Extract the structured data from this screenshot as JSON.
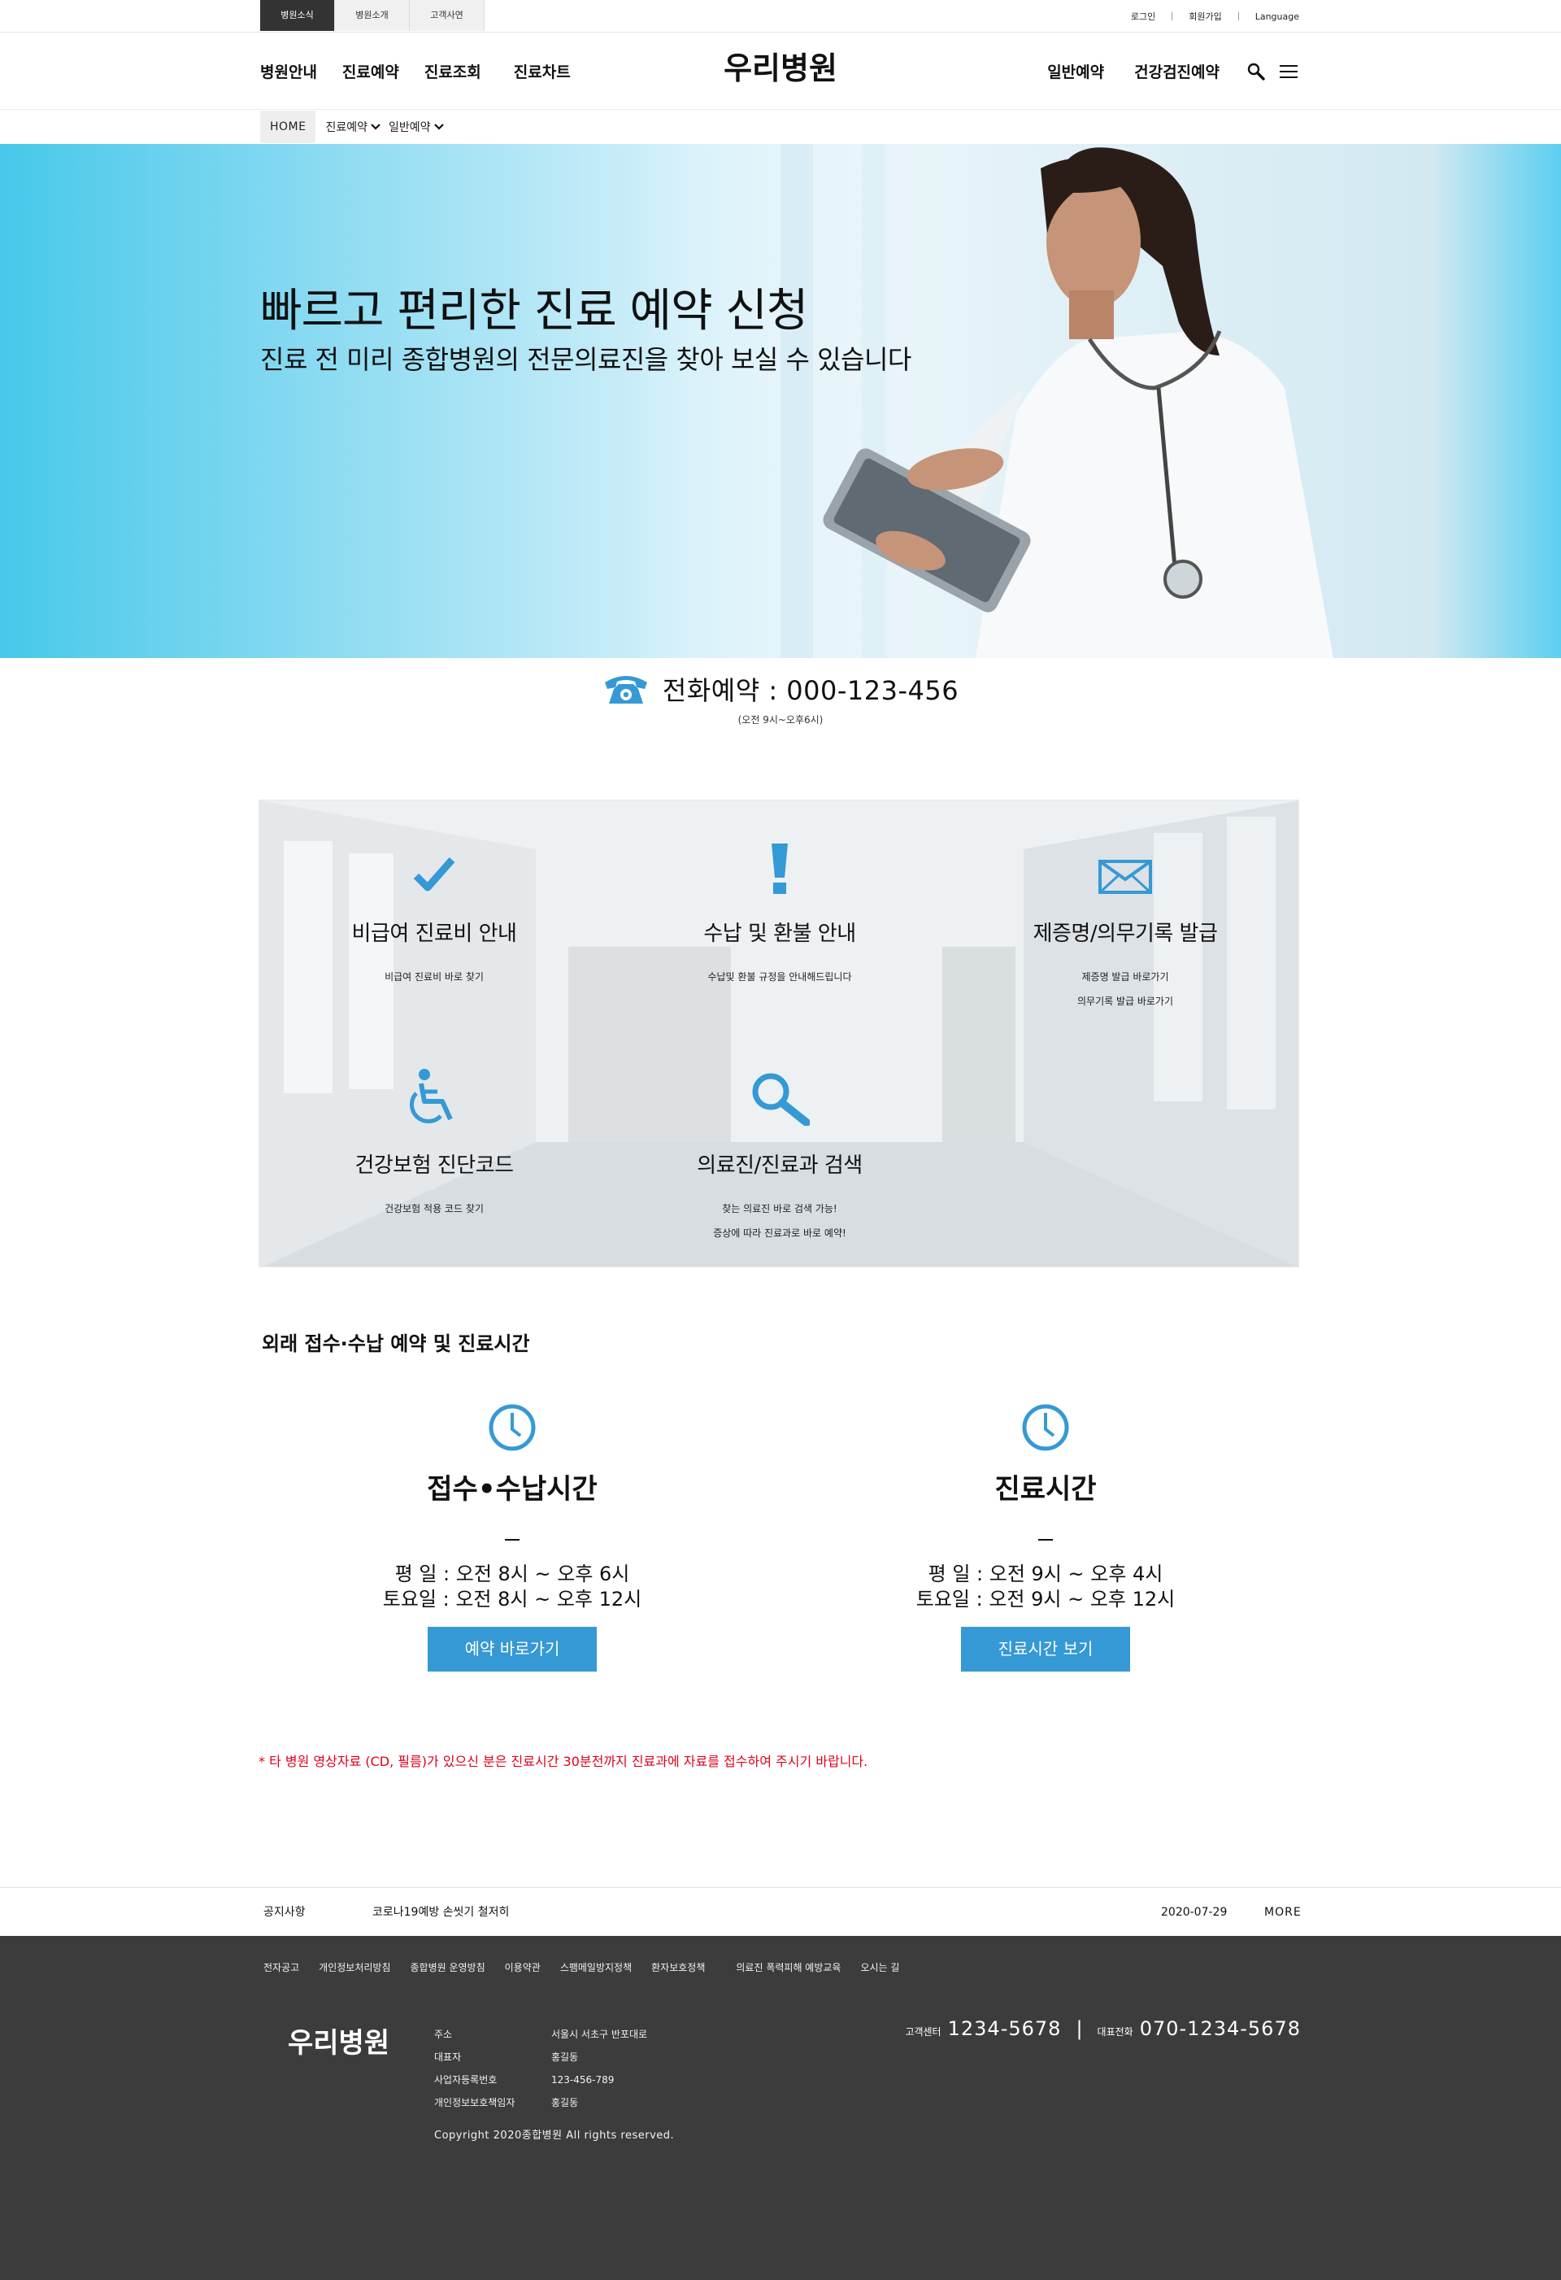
{
  "util_tabs": [
    "병원소식",
    "병원소개",
    "고객사연"
  ],
  "util_links": [
    "로그인",
    "회원가입",
    "Language"
  ],
  "header": {
    "nav_left": [
      "병원안내",
      "진료예약",
      "진료조회",
      "진료차트"
    ],
    "logo": "우리병원",
    "nav_right": [
      "일반예약",
      "건강검진예약"
    ]
  },
  "breadcrumb": {
    "home": "HOME",
    "items": [
      "진료예약",
      "일반예약"
    ]
  },
  "hero": {
    "title": "빠르고 편리한 진료 예약 신청",
    "subtitle": "진료 전 미리 종합병원의 전문의료진을 찾아 보실 수 있습니다"
  },
  "phone": {
    "label": "전화예약 : 000-123-456",
    "hours": "(오전 9시~오후6시)"
  },
  "services": [
    {
      "icon": "check-icon",
      "title": "비급여 진료비 안내",
      "lines": [
        "비급여 진료비 바로 찾기"
      ]
    },
    {
      "icon": "exclamation-icon",
      "title": "수납 및 환불 안내",
      "lines": [
        "수납및 환불 규정을 안내해드립니다"
      ]
    },
    {
      "icon": "envelope-icon",
      "title": "제증명/의무기록 발급",
      "lines": [
        "제증명 발급 바로가기",
        "의무기록 발급 바로가기"
      ]
    },
    {
      "icon": "wheelchair-icon",
      "title": "건강보험 진단코드",
      "lines": [
        "건강보험 적용 코드 찾기"
      ]
    },
    {
      "icon": "magnifier-icon",
      "title": "의료진/진료과 검색",
      "lines": [
        "찾는 의료진 바로 검색 가능!",
        "증상에 따라 진료과로 바로 예약!"
      ]
    }
  ],
  "hours": {
    "section_title": "외래 접수·수납 예약 및 진료시간",
    "columns": [
      {
        "title": "접수•수납시간",
        "rows": [
          "평 일 : 오전 8시 ~ 오후 6시",
          "토요일 : 오전 8시 ~ 오후 12시"
        ],
        "button": "예약 바로가기"
      },
      {
        "title": "진료시간",
        "rows": [
          "평 일 : 오전 9시 ~ 오후 4시",
          "토요일 : 오전 9시 ~ 오후 12시"
        ],
        "button": "진료시간 보기"
      }
    ]
  },
  "red_notice": "* 타 병원 영상자료 (CD, 필름)가 있으신 분은 진료시간 30분전까지 진료과에 자료를 접수하여 주시기 바랍니다.",
  "notice_bar": {
    "label": "공지사항",
    "text": "코로나19예방 손씻기 철저히",
    "date": "2020-07-29",
    "more": "MORE"
  },
  "footer": {
    "links": [
      "전자공고",
      "개인정보처리방침",
      "종합병원 운영방침",
      "이용약관",
      "스팸메일방지정책",
      "환자보호정책",
      "의료진 폭력피해 예방교육",
      "오시는 길"
    ],
    "logo": "우리병원",
    "info": [
      {
        "key": "주소",
        "value": "서울시 서초구 반포대로"
      },
      {
        "key": "대표자",
        "value": "홍길동"
      },
      {
        "key": "사업자등록번호",
        "value": "123-456-789"
      },
      {
        "key": "개인정보보호책임자",
        "value": "홍길동"
      }
    ],
    "copyright": "Copyright 2020종합병원 All rights reserved.",
    "contact": {
      "center_label": "고객센터",
      "center_number": "1234-5678",
      "rep_label": "대표전화",
      "rep_number": "070-1234-5678"
    }
  },
  "colors": {
    "accent": "#3599d5",
    "footer_bg": "#3c3c3c",
    "notice_red": "#e0001b"
  }
}
